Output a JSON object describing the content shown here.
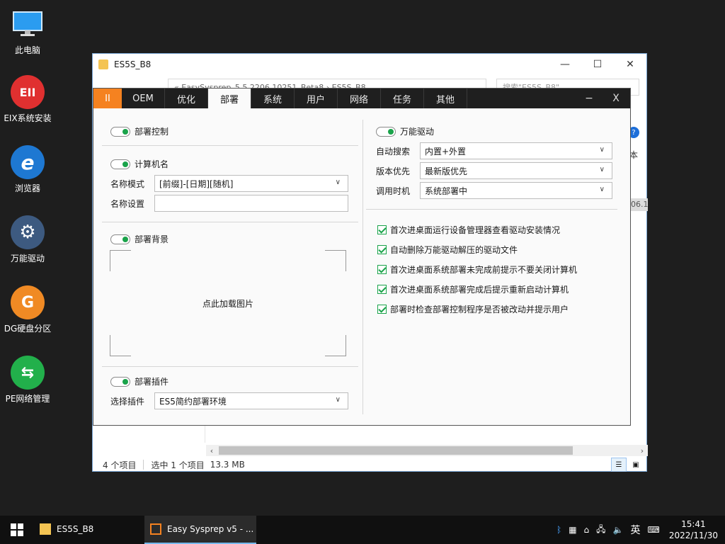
{
  "desktop": {
    "icons": [
      {
        "label": "此电脑",
        "icon": "computer-icon",
        "color": "#1e90ff"
      },
      {
        "label": "EIX系统安装",
        "icon": "eix-icon",
        "color": "#e03030",
        "glyph": "EII"
      },
      {
        "label": "浏览器",
        "icon": "browser-icon",
        "color": "#1e78d2",
        "glyph": "e"
      },
      {
        "label": "万能驱动",
        "icon": "gear-icon",
        "color": "#3d5a80",
        "glyph": "⚙"
      },
      {
        "label": "DG硬盘分区",
        "icon": "dg-icon",
        "color": "#f08a24",
        "glyph": "G"
      },
      {
        "label": "PE网络管理",
        "icon": "network-icon",
        "color": "#22b04b",
        "glyph": "⇆"
      }
    ]
  },
  "explorer": {
    "title": "ES5S_B8",
    "address": "« EasySysprep_5.5.2206.10251_Beta8 › ES5S_B8",
    "search_placeholder": "搜索\"ES5S_B8\"",
    "peek_help": "?",
    "peek_text": "本",
    "peek_date": "06.1",
    "status_items": "4 个项目",
    "status_selected": "选中 1 个项目",
    "status_size": "13.3 MB"
  },
  "sysprep": {
    "logo": "II",
    "tabs": [
      "OEM",
      "优化",
      "部署",
      "系统",
      "用户",
      "网络",
      "任务",
      "其他"
    ],
    "active_tab": "部署",
    "minimize": "−",
    "close": "X",
    "deploy_control": "部署控制",
    "computer_name": "计算机名",
    "name_mode_label": "名称模式",
    "name_mode_value": "[前缀]-[日期][随机]",
    "name_set_label": "名称设置",
    "name_set_value": "",
    "deploy_background": "部署背景",
    "load_image": "点此加载图片",
    "deploy_plugin": "部署插件",
    "select_plugin_label": "选择插件",
    "select_plugin_value": "ES5简约部署环境",
    "universal_driver": "万能驱动",
    "auto_search_label": "自动搜索",
    "auto_search_value": "内置+外置",
    "version_priority_label": "版本优先",
    "version_priority_value": "最新版优先",
    "call_timing_label": "调用时机",
    "call_timing_value": "系统部署中",
    "checks": [
      "首次进桌面运行设备管理器查看驱动安装情况",
      "自动删除万能驱动解压的驱动文件",
      "首次进桌面系统部署未完成前提示不要关闭计算机",
      "首次进桌面系统部署完成后提示重新启动计算机",
      "部署时检查部署控制程序是否被改动并提示用户"
    ],
    "accent_green": "#1aa34a",
    "logo_orange": "#f58220"
  },
  "taskbar": {
    "items": [
      {
        "label": "ES5S_B8",
        "icon": "folder-icon"
      },
      {
        "label": "Easy Sysprep v5 - ...",
        "icon": "sysprep-icon"
      }
    ],
    "tray": {
      "ime": "英",
      "time": "15:41",
      "date": "2022/11/30"
    }
  }
}
